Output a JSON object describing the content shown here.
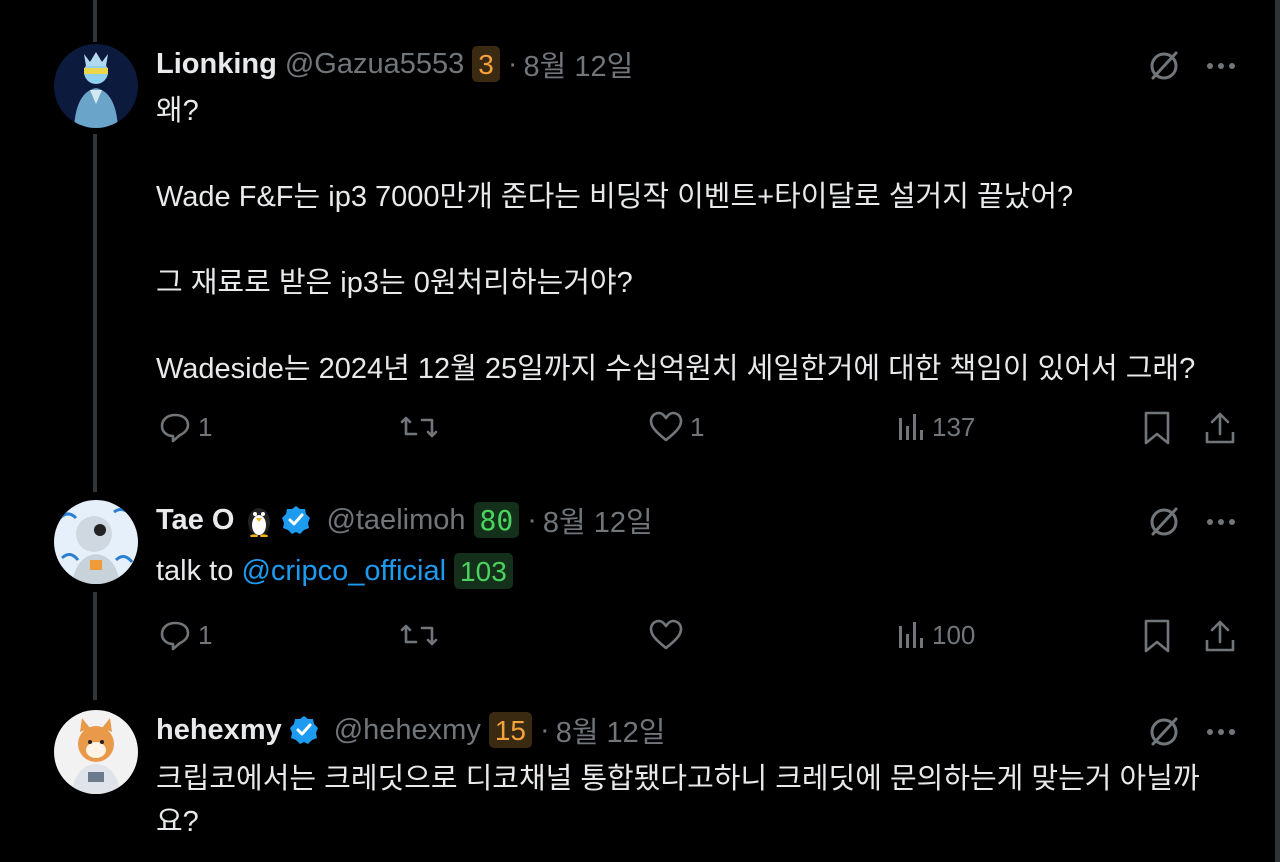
{
  "tweets": [
    {
      "name": "Lionking",
      "handle": "@Gazua5553",
      "badge": "3",
      "date": "8월 12일",
      "text": "왜?\n\nWade F&F는 ip3 7000만개 준다는 비딩작 이벤트+타이달로 설거지 끝났어?\n\n그 재료로 받은 ip3는 0원처리하는거야?\n\nWadeside는 2024년 12월 25일까지 수십억원치 세일한거에 대한 책임이 있어서 그래?",
      "stats": {
        "replies": "1",
        "reposts": "",
        "likes": "1",
        "views": "137"
      }
    },
    {
      "name": "Tae O",
      "emoji": "🐧",
      "handle": "@taelimoh",
      "badge": "80",
      "date": "8월 12일",
      "text_prefix": "talk to ",
      "mention": "@cripco_official",
      "mention_badge": "103",
      "stats": {
        "replies": "1",
        "reposts": "",
        "likes": "",
        "views": "100"
      }
    },
    {
      "name": "hehexmy",
      "handle": "@hehexmy",
      "badge": "15",
      "date": "8월 12일",
      "text": "크립코에서는 크레딧으로 디코채널 통합됐다고하니 크레딧에 문의하는게 맞는거 아닐까\n요?"
    }
  ],
  "colors": {
    "background": "#000000",
    "text": "#e7e9ea",
    "muted": "#71767b",
    "link": "#1d9bf0",
    "verified": "#1d9bf0"
  },
  "icons": [
    "reply-icon",
    "repost-icon",
    "like-icon",
    "views-icon",
    "bookmark-icon",
    "share-icon",
    "grok-icon",
    "more-icon",
    "verified-icon"
  ]
}
